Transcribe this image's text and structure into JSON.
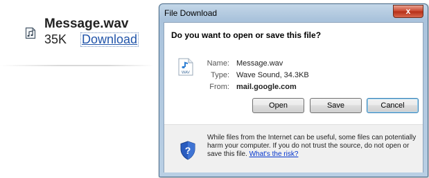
{
  "attachment": {
    "icon": "audio-file-icon",
    "filename": "Message.wav",
    "size": "35K",
    "download_label": "Download"
  },
  "dialog": {
    "title": "File Download",
    "close_label": "x",
    "question": "Do you want to open or save this file?",
    "file_icon": "wav-audio-icon",
    "file_icon_label": "WAV",
    "name_label": "Name:",
    "name_value": "Message.wav",
    "type_label": "Type:",
    "type_value": "Wave Sound, 34.3KB",
    "from_label": "From:",
    "from_value": "mail.google.com",
    "buttons": {
      "open": "Open",
      "save": "Save",
      "cancel": "Cancel"
    },
    "warning_icon": "shield-question-icon",
    "warning_text": "While files from the Internet can be useful, some files can potentially harm your computer. If you do not trust the source, do not open or save this file.",
    "warning_link": "What's the risk?"
  },
  "colors": {
    "link": "#2255aa",
    "titlebar": "#aac3dc",
    "close_button": "#c8442c",
    "shield_blue": "#2a5cbf"
  }
}
